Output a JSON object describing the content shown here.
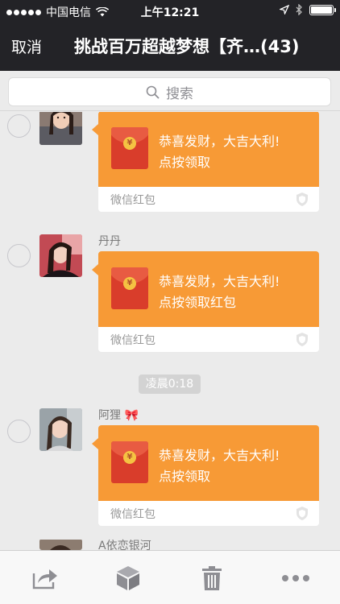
{
  "status_bar": {
    "carrier": "中国电信",
    "time": "上午12:21"
  },
  "nav": {
    "cancel_label": "取消",
    "title": "挑战百万超越梦想【齐…(43)"
  },
  "search": {
    "placeholder": "搜索"
  },
  "messages": [
    {
      "sender": "",
      "line1": "恭喜发财，大吉大利!",
      "line2": "点按领取",
      "footer": "微信红包"
    },
    {
      "sender": "丹丹",
      "line1": "恭喜发财，大吉大利!",
      "line2": "点按领取红包",
      "footer": "微信红包"
    },
    {
      "sender": "阿狸 🎀",
      "line1": "恭喜发财，大吉大利!",
      "line2": "点按领取",
      "footer": "微信红包"
    },
    {
      "sender": "A依恋银河"
    }
  ],
  "timestamp": "凌晨0:18",
  "envelope_coin": "¥",
  "colors": {
    "nav_bg": "#232327",
    "red_packet": "#f79a36",
    "envelope": "#d93d2b"
  },
  "toolbar": {
    "icons": [
      "share-icon",
      "favorite-box-icon",
      "trash-icon",
      "more-icon"
    ]
  }
}
